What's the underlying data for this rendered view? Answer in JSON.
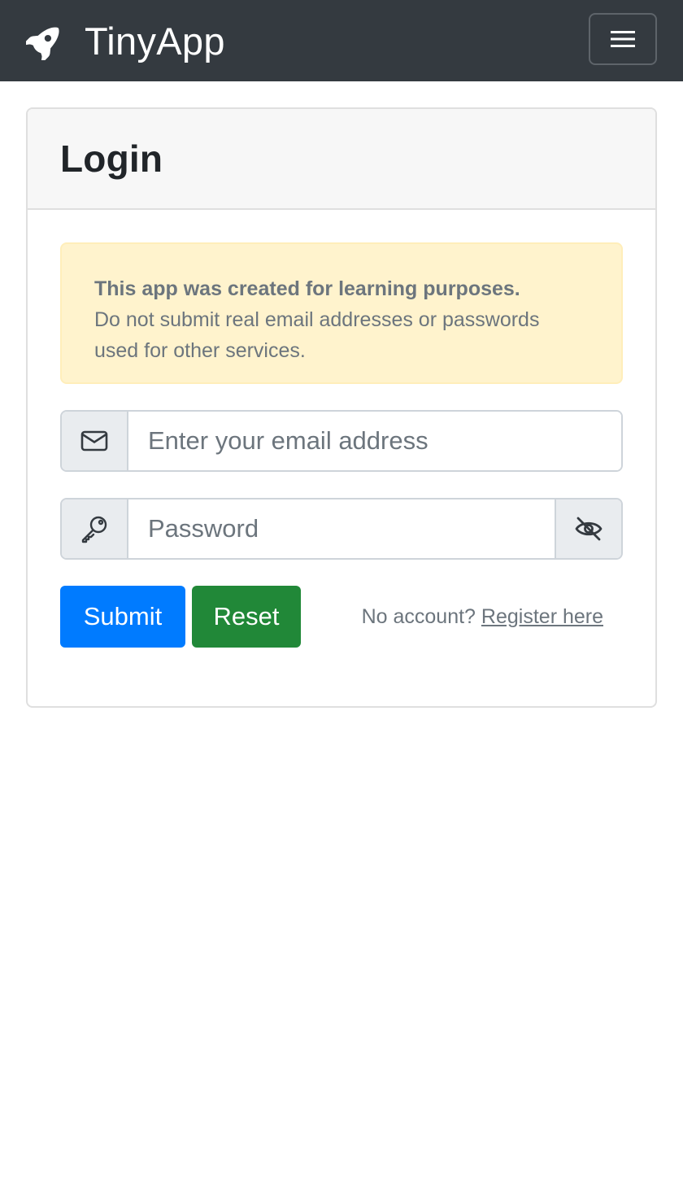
{
  "navbar": {
    "brand_name": "TinyApp",
    "brand_icon": "rocket-icon",
    "toggler_icon": "hamburger-menu-icon",
    "background": "#343a40"
  },
  "login_card": {
    "title": "Login",
    "alert": {
      "strong": "This app was created for learning purposes.",
      "body": "Do not submit real email addresses or passwords used for other services.",
      "background": "#fff3cd"
    },
    "email": {
      "icon": "envelope-icon",
      "placeholder": "Enter your email address",
      "value": ""
    },
    "password": {
      "icon": "key-icon",
      "placeholder": "Password",
      "value": "",
      "toggle_icon": "eye-slash-icon"
    },
    "submit_label": "Submit",
    "reset_label": "Reset",
    "register_prompt": "No account?",
    "register_link": "Register here"
  },
  "colors": {
    "primary": "#007bff",
    "success": "#218838",
    "muted": "#6c757d"
  }
}
